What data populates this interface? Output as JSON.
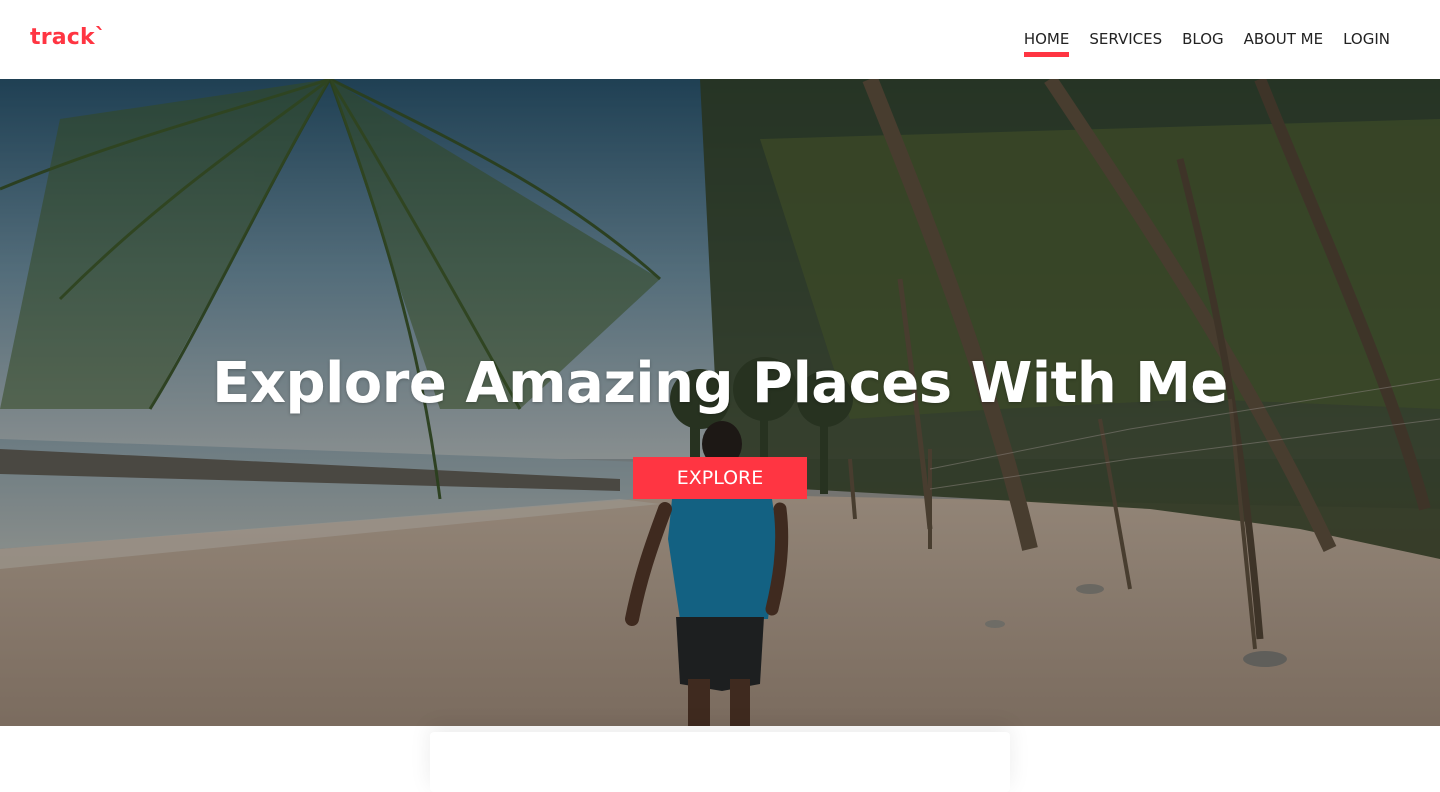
{
  "brand": {
    "logo_text": "track`",
    "accent_color": "#ff3542"
  },
  "nav": {
    "items": [
      {
        "label": "HOME",
        "active": true
      },
      {
        "label": "SERVICES",
        "active": false
      },
      {
        "label": "BLOG",
        "active": false
      },
      {
        "label": "ABOUT ME",
        "active": false
      },
      {
        "label": "LOGIN",
        "active": false
      }
    ]
  },
  "hero": {
    "title": "Explore Amazing Places With Me",
    "cta_label": "EXPLORE",
    "background_image": "beach-palm-trees-photo"
  }
}
